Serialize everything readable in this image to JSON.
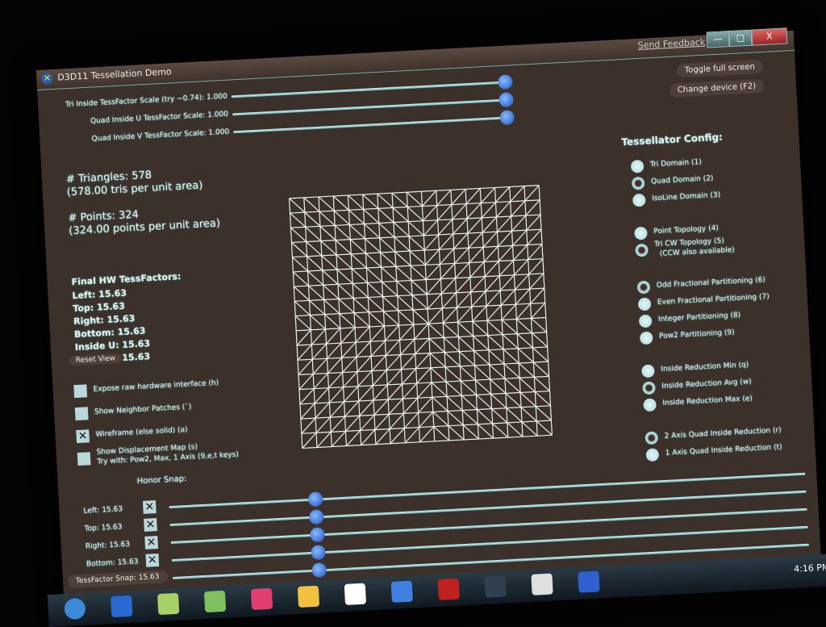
{
  "window": {
    "title": "D3D11 Tessellation Demo",
    "send_feedback": "Send Feedback",
    "minimize": "—",
    "maximize": "□",
    "close": "X"
  },
  "buttons": {
    "toggle_fullscreen": "Toggle full screen",
    "change_device": "Change device (F2)",
    "reset_view": "Reset View"
  },
  "scale_sliders": [
    {
      "label": "Tri Inside TessFactor Scale (try ~0.74): 1.000",
      "value": 1.0
    },
    {
      "label": "Quad Inside U TessFactor Scale: 1.000",
      "value": 1.0
    },
    {
      "label": "Quad Inside V TessFactor Scale: 1.000",
      "value": 1.0
    }
  ],
  "stats": {
    "triangles": "# Triangles: 578",
    "triangles_sub": "(578.00 tris per unit area)",
    "points": "# Points: 324",
    "points_sub": "(324.00 points per unit area)"
  },
  "final_factors": {
    "heading": "Final HW TessFactors:",
    "items": [
      "Left: 15.63",
      "Top: 15.63",
      "Right: 15.63",
      "Bottom: 15.63",
      "Inside U: 15.63",
      "Inside V: 15.63"
    ]
  },
  "options": [
    {
      "label": "Expose raw hardware interface (h)",
      "checked": false
    },
    {
      "label": "Show Neighbor Patches (`)",
      "checked": false
    },
    {
      "label": "Wireframe (else solid) (a)",
      "checked": true
    },
    {
      "label": "Show Displacement Map (s)",
      "sub": "Try with: Pow2, Max, 1 Axis (9,e,t keys)",
      "checked": false
    }
  ],
  "edge_sliders": {
    "honor_snap": "Honor Snap:",
    "check_mark": "✕",
    "items": [
      {
        "label": "Left: 15.63",
        "honor": true,
        "value": 0.23
      },
      {
        "label": "Top: 15.63",
        "honor": true,
        "value": 0.23
      },
      {
        "label": "Right: 15.63",
        "honor": true,
        "value": 0.23
      },
      {
        "label": "Bottom: 15.63",
        "honor": true,
        "value": 0.23
      }
    ],
    "snap": {
      "label": "TessFactor Snap: 15.63",
      "value": 0.23
    }
  },
  "config": {
    "heading": "Tessellator Config:",
    "groups": [
      [
        {
          "label": "Tri Domain (1)",
          "on": false
        },
        {
          "label": "Quad Domain (2)",
          "on": true
        },
        {
          "label": "IsoLine Domain (3)",
          "on": false
        }
      ],
      [
        {
          "label": "Point Topology (4)",
          "on": false
        },
        {
          "label": "Tri CW Topology (5)",
          "sub": "(CCW also available)",
          "on": true
        }
      ],
      [
        {
          "label": "Odd Fractional Partitioning (6)",
          "on": true
        },
        {
          "label": "Even Fractional Partitioning (7)",
          "on": false
        },
        {
          "label": "Integer Partitioning (8)",
          "on": false
        },
        {
          "label": "Pow2 Partitioning (9)",
          "on": false
        }
      ],
      [
        {
          "label": "Inside Reduction Min (q)",
          "on": false
        },
        {
          "label": "Inside Reduction Avg (w)",
          "on": true
        },
        {
          "label": "Inside Reduction Max (e)",
          "on": false
        }
      ],
      [
        {
          "label": "2 Axis Quad Inside Reduction (r)",
          "on": true
        },
        {
          "label": "1 Axis Quad Inside Reduction (t)",
          "on": false
        }
      ]
    ]
  },
  "mesh": {
    "segments": 17
  },
  "taskbar": {
    "clock": "4:16 PM",
    "icons": [
      "start-orb",
      "internet-explorer",
      "media-player",
      "folder",
      "paint",
      "app",
      "steam",
      "network",
      "pdf-reader",
      "command-prompt",
      "document",
      "tessellation-demo"
    ]
  }
}
